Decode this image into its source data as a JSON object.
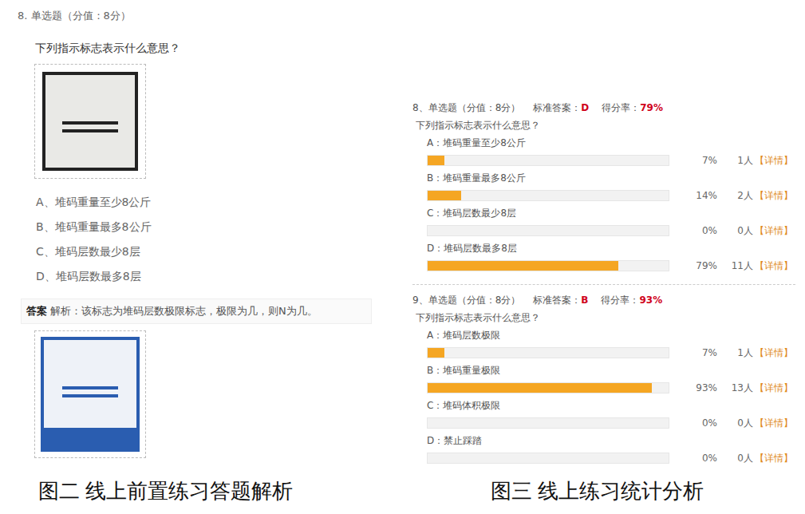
{
  "left": {
    "header": "8. 单选题（分值：8分）",
    "question": "下列指示标志表示什么意思？",
    "options": [
      "A、堆码重量至少8公斤",
      "B、堆码重量最多8公斤",
      "C、堆码层数最少8层",
      "D、堆码层数最多8层"
    ],
    "answer_label": "答案",
    "analysis": "解析：该标志为堆码层数极限标志，极限为几，则N为几。",
    "caption": "图二 线上前置练习答题解析"
  },
  "right": {
    "questions": [
      {
        "header": "8、单选题（分值：8分）",
        "answer_label": "标准答案：",
        "answer": "D",
        "rate_label": "得分率：",
        "rate": "79%",
        "question": "下列指示标志表示什么意思？",
        "options": [
          {
            "label": "A：堆码重量至少8公斤",
            "level": 0.07,
            "percent": "7%",
            "count": "1人",
            "detail": "【详情】"
          },
          {
            "label": "B：堆码重量最多8公斤",
            "level": 0.14,
            "percent": "14%",
            "count": "2人",
            "detail": "【详情】"
          },
          {
            "label": "C：堆码层数最少8层",
            "level": 0,
            "percent": "0%",
            "count": "0人",
            "detail": "【详情】"
          },
          {
            "label": "D：堆码层数最多8层",
            "level": 0.79,
            "percent": "79%",
            "count": "11人",
            "detail": "【详情】"
          }
        ]
      },
      {
        "header": "9、单选题（分值：8分）",
        "answer_label": "标准答案：",
        "answer": "B",
        "rate_label": "得分率：",
        "rate": "93%",
        "question": "下列指示标志表示什么意思？",
        "options": [
          {
            "label": "A：堆码层数极限",
            "level": 0.07,
            "percent": "7%",
            "count": "1人",
            "detail": "【详情】"
          },
          {
            "label": "B：堆码重量极限",
            "level": 0.93,
            "percent": "93%",
            "count": "13人",
            "detail": "【详情】"
          },
          {
            "label": "C：堆码体积极限",
            "level": 0,
            "percent": "0%",
            "count": "0人",
            "detail": "【详情】"
          },
          {
            "label": "D：禁止踩踏",
            "level": 0,
            "percent": "0%",
            "count": "0人",
            "detail": "【详情】"
          }
        ]
      }
    ],
    "caption": "图三 线上练习统计分析"
  }
}
